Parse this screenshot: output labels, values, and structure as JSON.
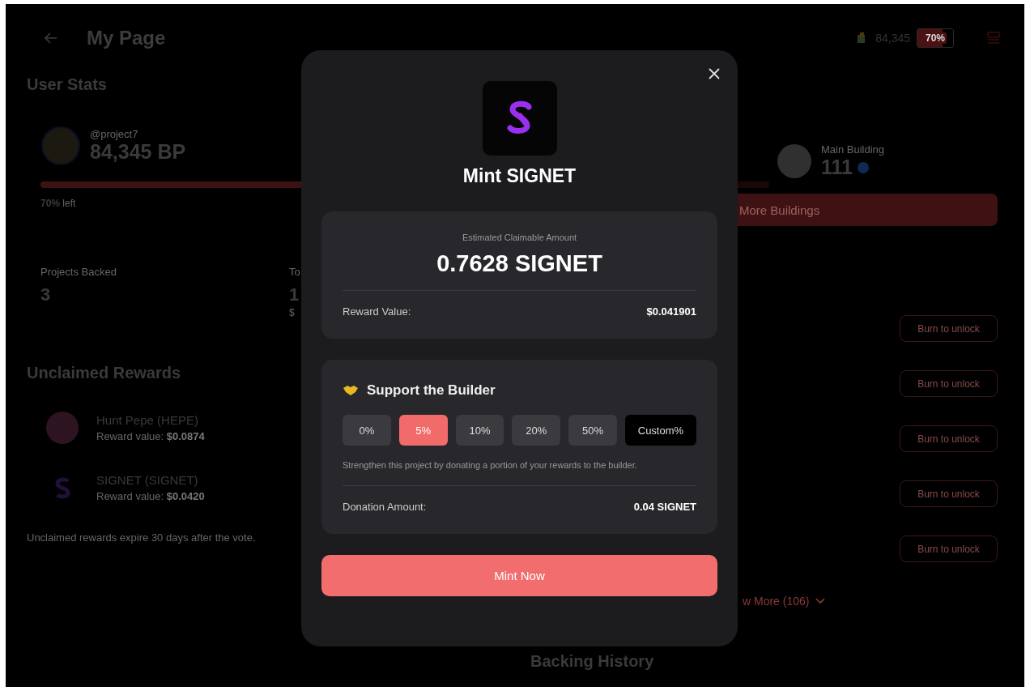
{
  "header": {
    "title": "My Page",
    "points": "84,345",
    "energy": {
      "label": "70%",
      "level": 0.7
    }
  },
  "user_stats": {
    "heading": "User Stats",
    "handle": "@project7",
    "points": "84,345 BP",
    "progress": {
      "level": 0.7
    },
    "remaining": "**70%** left",
    "main_building": {
      "label": "Main Building",
      "value": "111"
    },
    "more_buildings_button": "More Buildings",
    "stats": [
      {
        "label": "Projects Backed",
        "value": "3"
      },
      {
        "label": "To",
        "value": "1",
        "sub": "$"
      }
    ]
  },
  "unclaimed": {
    "heading": "Unclaimed Rewards",
    "rewards": [
      {
        "kind": "pepe",
        "name": "Hunt Pepe (HEPE)",
        "value_label": "Reward value:",
        "value": "$0.0874"
      },
      {
        "kind": "signet",
        "name": "SIGNET (SIGNET)",
        "value_label": "Reward value:",
        "value": "$0.0420"
      }
    ],
    "note": "Unclaimed rewards expire 30 days after the vote."
  },
  "unlock_buttons": [
    "Burn to unlock",
    "Burn to unlock",
    "Burn to unlock",
    "Burn to unlock",
    "Burn to unlock"
  ],
  "show_more": "w More (106)",
  "backing_history": "Backing History",
  "modal": {
    "title": "Mint SIGNET",
    "estimate": {
      "label": "Estimated Claimable Amount",
      "amount": "0.7628 SIGNET",
      "reward_label": "Reward Value:",
      "reward_value": "$0.041901"
    },
    "support": {
      "heading": "Support the Builder",
      "options": [
        {
          "kind": "preset",
          "label": "0%",
          "selected": false
        },
        {
          "kind": "preset",
          "label": "5%",
          "selected": true
        },
        {
          "kind": "preset",
          "label": "10%",
          "selected": false
        },
        {
          "kind": "preset",
          "label": "20%",
          "selected": false
        },
        {
          "kind": "preset",
          "label": "50%",
          "selected": false
        },
        {
          "kind": "custom",
          "label": "Custom%",
          "selected": false
        }
      ],
      "description": "Strengthen this project by donating a portion of your rewards to the builder.",
      "donation_label": "Donation Amount:",
      "donation_value": "0.04 SIGNET"
    },
    "primary_button": "Mint Now"
  }
}
